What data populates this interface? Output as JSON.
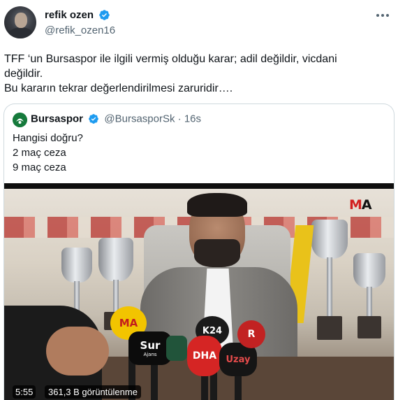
{
  "tweet": {
    "author_name": "refik ozen",
    "author_handle": "@refik_ozen16",
    "lines": [
      "TFF ‘un Bursaspor ile ilgili vermiş olduğu karar; adil değildir, vicdani",
      "değildir.",
      "Bu kararın tekrar değerlendirilmesi zaruridir…."
    ],
    "more_icon": "ellipsis-icon",
    "verified_icon": "verified-badge-icon"
  },
  "quote": {
    "author_name": "Bursaspor",
    "author_handle": "@BursasporSk",
    "separator": "·",
    "time": "16s",
    "lines": [
      "Hangisi doğru?",
      "2 maç ceza",
      "9 maç ceza"
    ]
  },
  "video": {
    "duration": "5:55",
    "views": "361,3 B görüntülenme",
    "watermark": {
      "prefix": "M",
      "suffix": "A"
    },
    "mics": [
      "MA",
      "Sur",
      "K24",
      "DHA",
      "Uzay",
      "R"
    ],
    "mic_sub": "Ajans"
  },
  "colors": {
    "verified": "#1d9bf0",
    "text": "#0f1419",
    "secondary": "#536471",
    "border": "#cfd9de"
  }
}
